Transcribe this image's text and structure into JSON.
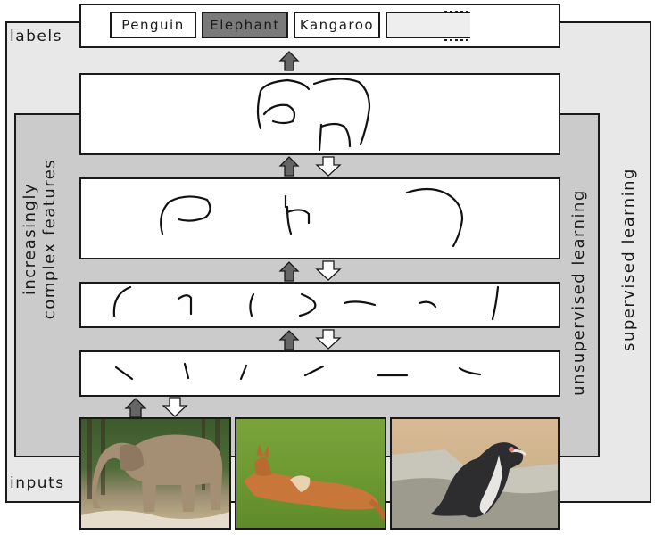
{
  "side_labels": {
    "labels": "labels",
    "inputs": "inputs"
  },
  "vertical_labels": {
    "left": [
      "increasingly",
      "complex features"
    ],
    "middle": "unsupervised learning",
    "right": "supervised learning"
  },
  "output_labels": [
    {
      "text": "Penguin",
      "highlighted": false
    },
    {
      "text": "Elephant",
      "highlighted": true
    },
    {
      "text": "Kangaroo",
      "highlighted": false
    }
  ],
  "images": [
    {
      "subject": "elephant"
    },
    {
      "subject": "kangaroo"
    },
    {
      "subject": "penguin"
    }
  ],
  "colors": {
    "outer_panel": "#e8e8e8",
    "inner_panel": "#cbcbcb",
    "up_arrow": "#666666",
    "down_arrow": "#ffffff",
    "highlight_chip": "#7a7a7a"
  }
}
